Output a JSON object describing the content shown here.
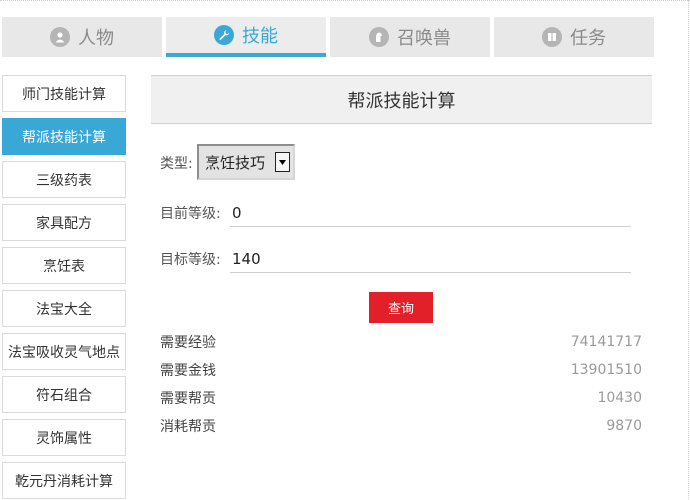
{
  "tabs": [
    {
      "label": "人物",
      "icon": "person-icon",
      "active": false
    },
    {
      "label": "技能",
      "icon": "wrench-icon",
      "active": true
    },
    {
      "label": "召唤兽",
      "icon": "pet-icon",
      "active": false
    },
    {
      "label": "任务",
      "icon": "book-icon",
      "active": false
    }
  ],
  "sidebar": {
    "items": [
      {
        "label": "师门技能计算"
      },
      {
        "label": "帮派技能计算"
      },
      {
        "label": "三级药表"
      },
      {
        "label": "家具配方"
      },
      {
        "label": "烹饪表"
      },
      {
        "label": "法宝大全"
      },
      {
        "label": "法宝吸收灵气地点"
      },
      {
        "label": "符石组合"
      },
      {
        "label": "灵饰属性"
      },
      {
        "label": "乾元丹消耗计算"
      }
    ],
    "active_index": 1
  },
  "panel": {
    "title": "帮派技能计算",
    "type_label": "类型:",
    "type_selected": "烹饪技巧",
    "current_level_label": "目前等级:",
    "current_level_value": "0",
    "target_level_label": "目标等级:",
    "target_level_value": "140",
    "query_label": "查询"
  },
  "results": [
    {
      "label": "需要经验",
      "value": "74141717"
    },
    {
      "label": "需要金钱",
      "value": "13901510"
    },
    {
      "label": "需要帮贡",
      "value": "10430"
    },
    {
      "label": "消耗帮贡",
      "value": "9870"
    }
  ],
  "colors": {
    "accent": "#3aa8d6",
    "button": "#e2202a"
  }
}
